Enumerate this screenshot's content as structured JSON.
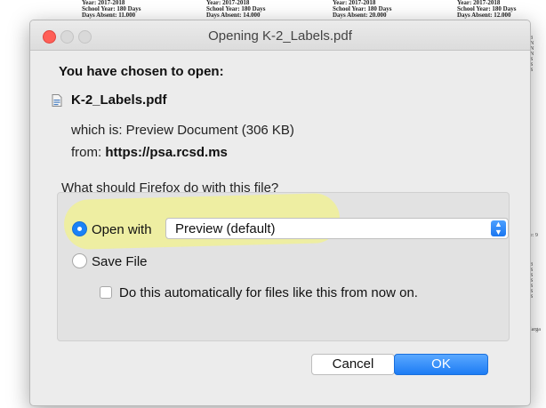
{
  "background": {
    "columns": [
      {
        "year": "Year: 2017-2018",
        "school_year": "School Year: 180 Days",
        "absent": "Days Absent: 11.000"
      },
      {
        "year": "Year: 2017-2018",
        "school_year": "School Year: 180 Days",
        "absent": "Days Absent: 14.000"
      },
      {
        "year": "Year: 2017-2018",
        "school_year": "School Year: 180 Days",
        "absent": "Days Absent: 20.000"
      },
      {
        "year": "Year: 2017-2018",
        "school_year": "School Year: 180 Days",
        "absent": "Days Absent: 12.000"
      }
    ],
    "side_fragments": [
      {
        "text": "8\nN\nN\nN\nS\nS\nS"
      },
      {
        "text": "e: 9"
      },
      {
        "text": "8\nS\nS\nS\nS\nS\nS"
      },
      {
        "text": "larga"
      }
    ]
  },
  "dialog": {
    "title": "Opening K-2_Labels.pdf",
    "heading": "You have chosen to open:",
    "file_name": "K-2_Labels.pdf",
    "file_icon": "pdf-file-icon",
    "which_is": "which is: Preview Document (306 KB)",
    "from_label": "from:",
    "from_url": "https://psa.rcsd.ms",
    "question": "What should Firefox do with this file?",
    "open_with_label": "Open with",
    "open_with_value": "Preview (default)",
    "save_file_label": "Save File",
    "auto_label": "Do this automatically for files like this from now on.",
    "cancel_label": "Cancel",
    "ok_label": "OK",
    "selected_option": "Open with",
    "auto_checked": false
  },
  "colors": {
    "accent": "#1a82f7",
    "close_button": "#ff5f57",
    "highlight": "#f8f86e"
  }
}
